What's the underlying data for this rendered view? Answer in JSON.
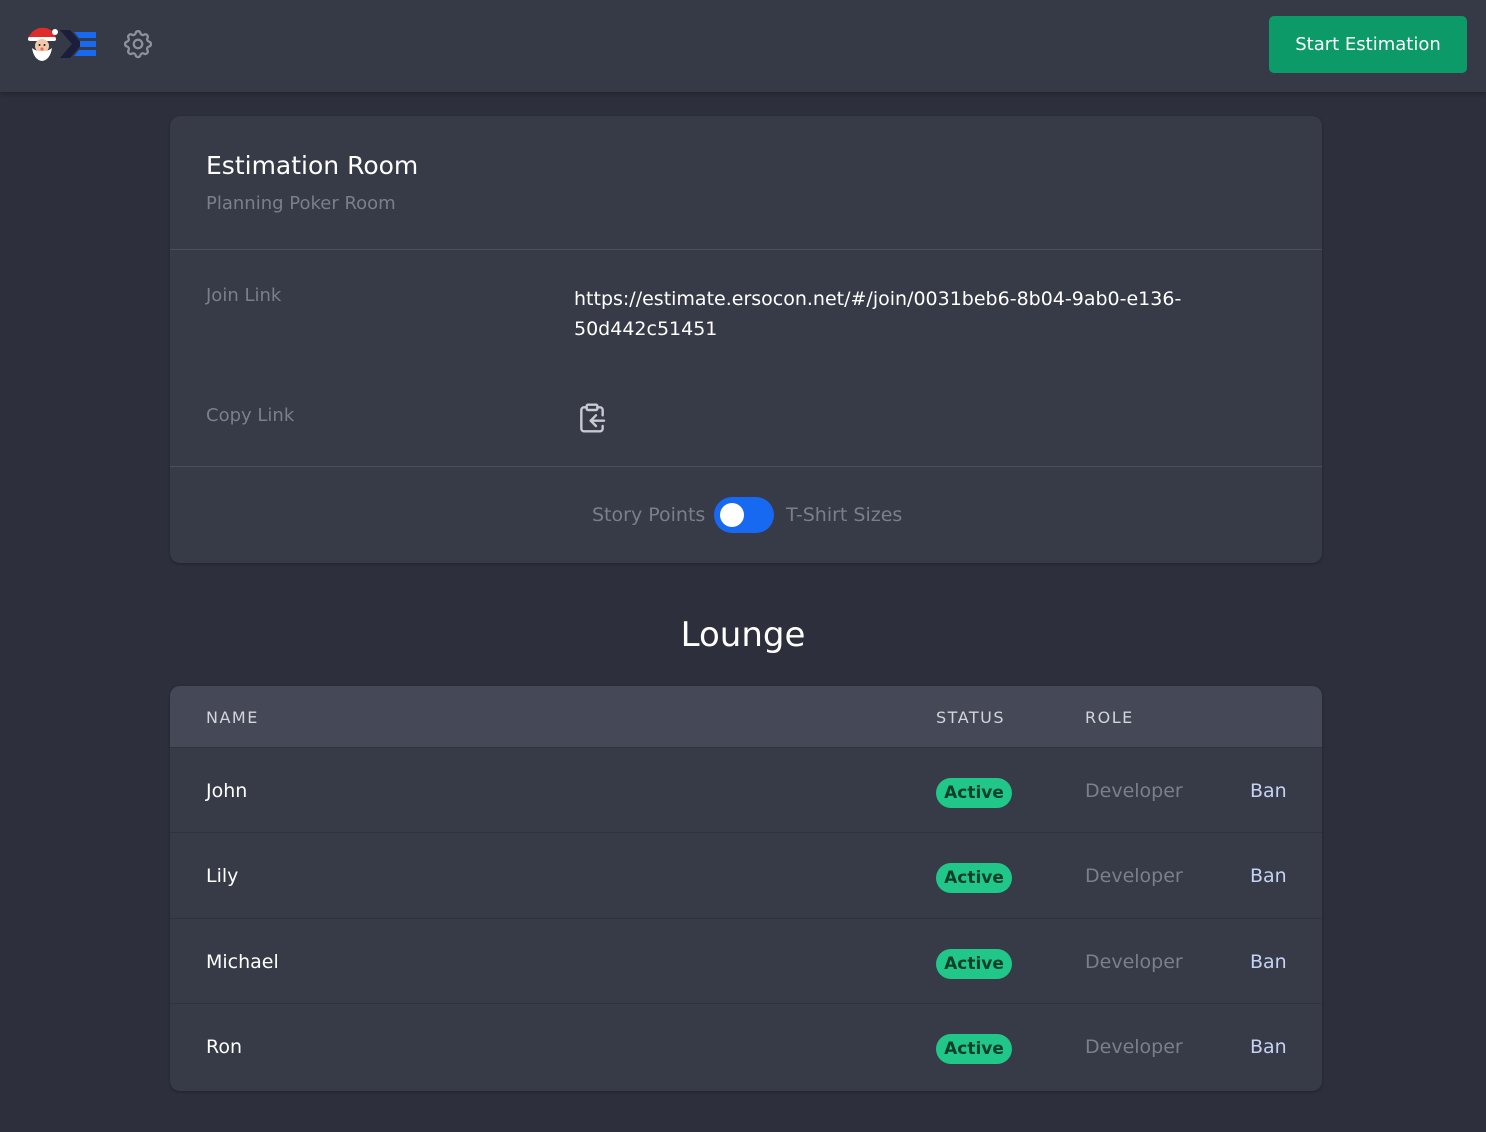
{
  "header": {
    "logo_name": "santa-logo",
    "settings_icon": "gear-icon",
    "start_button_label": "Start Estimation",
    "accent_color": "#0b9a68"
  },
  "room": {
    "title": "Estimation Room",
    "subtitle": "Planning Poker Room",
    "join_link_label": "Join Link",
    "join_link_value": "https://estimate.ersocon.net/#/join/0031beb6-8b04-9ab0-e136-50d442c51451",
    "copy_link_label": "Copy Link",
    "copy_icon": "clipboard-copy-icon",
    "toggle": {
      "left_label": "Story Points",
      "right_label": "T-Shirt Sizes",
      "color": "#1769f1"
    }
  },
  "lounge": {
    "title": "Lounge",
    "columns": {
      "name": "NAME",
      "status": "STATUS",
      "role": "ROLE"
    },
    "status_color": "#21c788",
    "rows": [
      {
        "name": "John",
        "status": "Active",
        "role": "Developer",
        "action": "Ban"
      },
      {
        "name": "Lily",
        "status": "Active",
        "role": "Developer",
        "action": "Ban"
      },
      {
        "name": "Michael",
        "status": "Active",
        "role": "Developer",
        "action": "Ban"
      },
      {
        "name": "Ron",
        "status": "Active",
        "role": "Developer",
        "action": "Ban"
      }
    ]
  }
}
